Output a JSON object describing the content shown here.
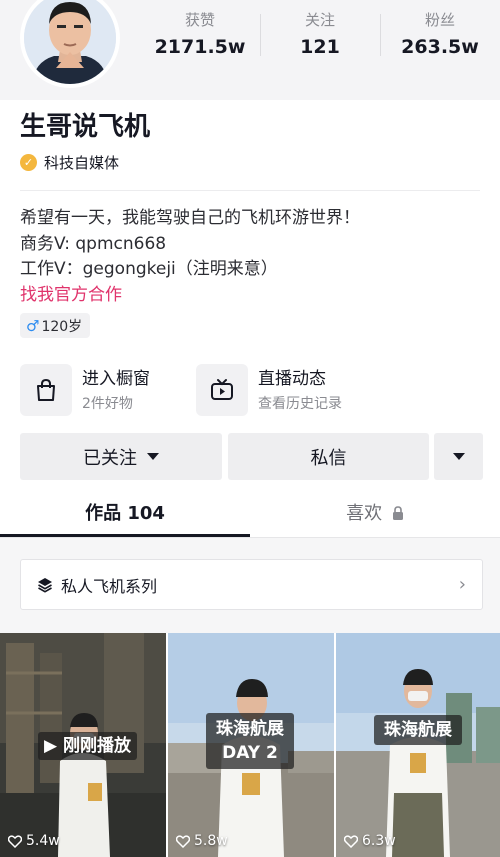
{
  "profile": {
    "name": "生哥说飞机",
    "certification": "科技自媒体",
    "stats": [
      {
        "label": "获赞",
        "value": "2171.5w"
      },
      {
        "label": "关注",
        "value": "121"
      },
      {
        "label": "粉丝",
        "value": "263.5w"
      }
    ],
    "bio": [
      "希望有一天，我能驾驶自己的飞机环游世界！",
      "商务V: qpmcn668",
      "工作V：gegongkeji（注明来意）"
    ],
    "bio_link": "找我官方合作",
    "tag": {
      "gender_symbol": "♂",
      "age": "120岁"
    }
  },
  "entries": {
    "shop": {
      "title": "进入橱窗",
      "subtitle": "2件好物",
      "icon": "shopping-bag-icon"
    },
    "live": {
      "title": "直播动态",
      "subtitle": "查看历史记录",
      "icon": "tv-icon"
    }
  },
  "actions": {
    "followed": "已关注",
    "message": "私信"
  },
  "tabs": {
    "works": "作品 104",
    "likes": "喜欢"
  },
  "collection": {
    "label": "私人飞机系列",
    "icon": "layers-icon"
  },
  "videos": [
    {
      "badge": "▶ 刚刚播放",
      "likes": "5.4w"
    },
    {
      "badge_line1": "珠海航展",
      "badge_line2": "DAY 2",
      "likes": "5.8w"
    },
    {
      "badge": "珠海航展",
      "likes": "6.3w"
    }
  ],
  "colors": {
    "accent_link": "#e0336b",
    "gender_blue": "#2d8cf0",
    "cert_gold": "#f4b73e",
    "button_bg": "#eeeef0"
  }
}
